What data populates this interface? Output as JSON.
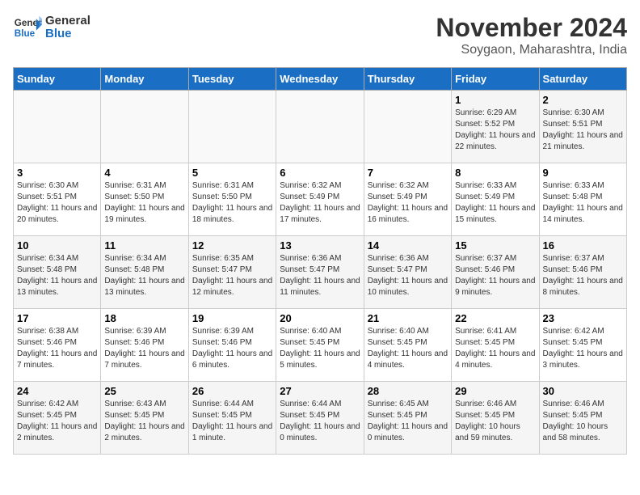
{
  "logo": {
    "line1": "General",
    "line2": "Blue"
  },
  "title": "November 2024",
  "subtitle": "Soygaon, Maharashtra, India",
  "days_of_week": [
    "Sunday",
    "Monday",
    "Tuesday",
    "Wednesday",
    "Thursday",
    "Friday",
    "Saturday"
  ],
  "weeks": [
    [
      {
        "day": "",
        "info": ""
      },
      {
        "day": "",
        "info": ""
      },
      {
        "day": "",
        "info": ""
      },
      {
        "day": "",
        "info": ""
      },
      {
        "day": "",
        "info": ""
      },
      {
        "day": "1",
        "info": "Sunrise: 6:29 AM\nSunset: 5:52 PM\nDaylight: 11 hours and 22 minutes."
      },
      {
        "day": "2",
        "info": "Sunrise: 6:30 AM\nSunset: 5:51 PM\nDaylight: 11 hours and 21 minutes."
      }
    ],
    [
      {
        "day": "3",
        "info": "Sunrise: 6:30 AM\nSunset: 5:51 PM\nDaylight: 11 hours and 20 minutes."
      },
      {
        "day": "4",
        "info": "Sunrise: 6:31 AM\nSunset: 5:50 PM\nDaylight: 11 hours and 19 minutes."
      },
      {
        "day": "5",
        "info": "Sunrise: 6:31 AM\nSunset: 5:50 PM\nDaylight: 11 hours and 18 minutes."
      },
      {
        "day": "6",
        "info": "Sunrise: 6:32 AM\nSunset: 5:49 PM\nDaylight: 11 hours and 17 minutes."
      },
      {
        "day": "7",
        "info": "Sunrise: 6:32 AM\nSunset: 5:49 PM\nDaylight: 11 hours and 16 minutes."
      },
      {
        "day": "8",
        "info": "Sunrise: 6:33 AM\nSunset: 5:49 PM\nDaylight: 11 hours and 15 minutes."
      },
      {
        "day": "9",
        "info": "Sunrise: 6:33 AM\nSunset: 5:48 PM\nDaylight: 11 hours and 14 minutes."
      }
    ],
    [
      {
        "day": "10",
        "info": "Sunrise: 6:34 AM\nSunset: 5:48 PM\nDaylight: 11 hours and 13 minutes."
      },
      {
        "day": "11",
        "info": "Sunrise: 6:34 AM\nSunset: 5:48 PM\nDaylight: 11 hours and 13 minutes."
      },
      {
        "day": "12",
        "info": "Sunrise: 6:35 AM\nSunset: 5:47 PM\nDaylight: 11 hours and 12 minutes."
      },
      {
        "day": "13",
        "info": "Sunrise: 6:36 AM\nSunset: 5:47 PM\nDaylight: 11 hours and 11 minutes."
      },
      {
        "day": "14",
        "info": "Sunrise: 6:36 AM\nSunset: 5:47 PM\nDaylight: 11 hours and 10 minutes."
      },
      {
        "day": "15",
        "info": "Sunrise: 6:37 AM\nSunset: 5:46 PM\nDaylight: 11 hours and 9 minutes."
      },
      {
        "day": "16",
        "info": "Sunrise: 6:37 AM\nSunset: 5:46 PM\nDaylight: 11 hours and 8 minutes."
      }
    ],
    [
      {
        "day": "17",
        "info": "Sunrise: 6:38 AM\nSunset: 5:46 PM\nDaylight: 11 hours and 7 minutes."
      },
      {
        "day": "18",
        "info": "Sunrise: 6:39 AM\nSunset: 5:46 PM\nDaylight: 11 hours and 7 minutes."
      },
      {
        "day": "19",
        "info": "Sunrise: 6:39 AM\nSunset: 5:46 PM\nDaylight: 11 hours and 6 minutes."
      },
      {
        "day": "20",
        "info": "Sunrise: 6:40 AM\nSunset: 5:45 PM\nDaylight: 11 hours and 5 minutes."
      },
      {
        "day": "21",
        "info": "Sunrise: 6:40 AM\nSunset: 5:45 PM\nDaylight: 11 hours and 4 minutes."
      },
      {
        "day": "22",
        "info": "Sunrise: 6:41 AM\nSunset: 5:45 PM\nDaylight: 11 hours and 4 minutes."
      },
      {
        "day": "23",
        "info": "Sunrise: 6:42 AM\nSunset: 5:45 PM\nDaylight: 11 hours and 3 minutes."
      }
    ],
    [
      {
        "day": "24",
        "info": "Sunrise: 6:42 AM\nSunset: 5:45 PM\nDaylight: 11 hours and 2 minutes."
      },
      {
        "day": "25",
        "info": "Sunrise: 6:43 AM\nSunset: 5:45 PM\nDaylight: 11 hours and 2 minutes."
      },
      {
        "day": "26",
        "info": "Sunrise: 6:44 AM\nSunset: 5:45 PM\nDaylight: 11 hours and 1 minute."
      },
      {
        "day": "27",
        "info": "Sunrise: 6:44 AM\nSunset: 5:45 PM\nDaylight: 11 hours and 0 minutes."
      },
      {
        "day": "28",
        "info": "Sunrise: 6:45 AM\nSunset: 5:45 PM\nDaylight: 11 hours and 0 minutes."
      },
      {
        "day": "29",
        "info": "Sunrise: 6:46 AM\nSunset: 5:45 PM\nDaylight: 10 hours and 59 minutes."
      },
      {
        "day": "30",
        "info": "Sunrise: 6:46 AM\nSunset: 5:45 PM\nDaylight: 10 hours and 58 minutes."
      }
    ]
  ]
}
